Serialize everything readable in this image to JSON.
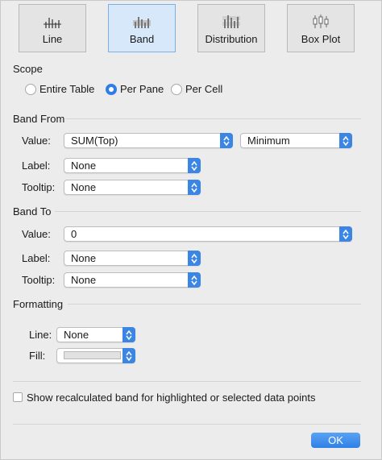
{
  "tabs": [
    {
      "label": "Line",
      "icon": "line-reference-icon",
      "selected": false
    },
    {
      "label": "Band",
      "icon": "band-reference-icon",
      "selected": true
    },
    {
      "label": "Distribution",
      "icon": "distribution-reference-icon",
      "selected": false
    },
    {
      "label": "Box Plot",
      "icon": "box-plot-icon",
      "selected": false
    }
  ],
  "scope": {
    "title": "Scope",
    "options": [
      "Entire Table",
      "Per Pane",
      "Per Cell"
    ],
    "selected": "Per Pane"
  },
  "band_from": {
    "title": "Band From",
    "value_label": "Value:",
    "value": "SUM(Top)",
    "aggregation": "Minimum",
    "label_label": "Label:",
    "label": "None",
    "tooltip_label": "Tooltip:",
    "tooltip": "None"
  },
  "band_to": {
    "title": "Band To",
    "value_label": "Value:",
    "value": "0",
    "label_label": "Label:",
    "label": "None",
    "tooltip_label": "Tooltip:",
    "tooltip": "None"
  },
  "formatting": {
    "title": "Formatting",
    "line_label": "Line:",
    "line": "None",
    "fill_label": "Fill:"
  },
  "recalc_checkbox": {
    "label": "Show recalculated band for highlighted or selected data points",
    "checked": false
  },
  "ok_label": "OK",
  "colors": {
    "accent": "#2f7ee6",
    "tab_selected": "#d7e8fb",
    "background": "#ececec"
  }
}
